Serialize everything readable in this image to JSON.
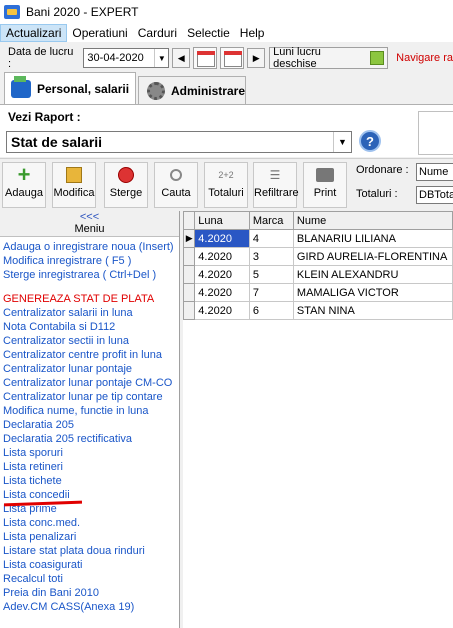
{
  "window": {
    "title": "Bani 2020 - EXPERT"
  },
  "menu": [
    "Actualizari",
    "Operatiuni",
    "Carduri",
    "Selectie",
    "Help"
  ],
  "datebar": {
    "label": "Data de lucru :",
    "date": "30-04-2020",
    "luni_label": "Luni lucru deschise",
    "navigare_label": "Navigare ra"
  },
  "tabs": [
    "Personal, salarii",
    "Administrare"
  ],
  "report": {
    "label": "Vezi Raport :",
    "value": "Stat de salarii",
    "help": "?"
  },
  "toolbar": {
    "buttons": [
      "Adauga",
      "Modifica",
      "Sterge",
      "Cauta",
      "Totaluri",
      "Refiltrare",
      "Print"
    ],
    "totaluri_icon_text": "2+2",
    "ordonare_label": "Ordonare :",
    "ordonare_value": "Nume",
    "totaluri_label": "Totaluri :",
    "totaluri_value": "DBTota"
  },
  "sidebar": {
    "arrows": "<<<",
    "title": "Meniu",
    "items": [
      "Adauga o inregistrare noua (Insert)",
      "Modifica inregistrare ( F5 )",
      "Sterge inregistrarea ( Ctrl+Del )",
      "GENEREAZA STAT DE PLATA",
      "Centralizator salarii in luna",
      "Nota Contabila si D112",
      "Centralizator sectii in luna",
      "Centralizator centre profit in luna",
      "Centralizator lunar pontaje",
      "Centralizator lunar pontaje CM-CO",
      "Centralizator lunar pe tip contare",
      "Modifica nume, functie in luna",
      "Declaratia 205",
      "Declaratia 205 rectificativa",
      "Lista sporuri",
      "Lista retineri",
      "Lista tichete",
      "Lista concedii",
      "Lista prime",
      "Lista conc.med.",
      "Lista penalizari",
      "Listare stat plata doua rinduri",
      "Lista coasigurati",
      "Recalcul toti",
      "Preia din Bani 2010",
      "Adev.CM CASS(Anexa 19)"
    ]
  },
  "grid": {
    "columns": [
      "Luna",
      "Marca",
      "Nume"
    ],
    "rows": [
      [
        "4.2020",
        "4",
        "BLANARIU LILIANA"
      ],
      [
        "4.2020",
        "3",
        "GIRD AURELIA-FLORENTINA"
      ],
      [
        "4.2020",
        "5",
        "KLEIN ALEXANDRU"
      ],
      [
        "4.2020",
        "7",
        "MAMALIGA VICTOR"
      ],
      [
        "4.2020",
        "6",
        "STAN NINA"
      ]
    ]
  },
  "colors": {
    "link": "#1a56c8",
    "highlight": "#e00000",
    "selection": "#2a57c4"
  }
}
